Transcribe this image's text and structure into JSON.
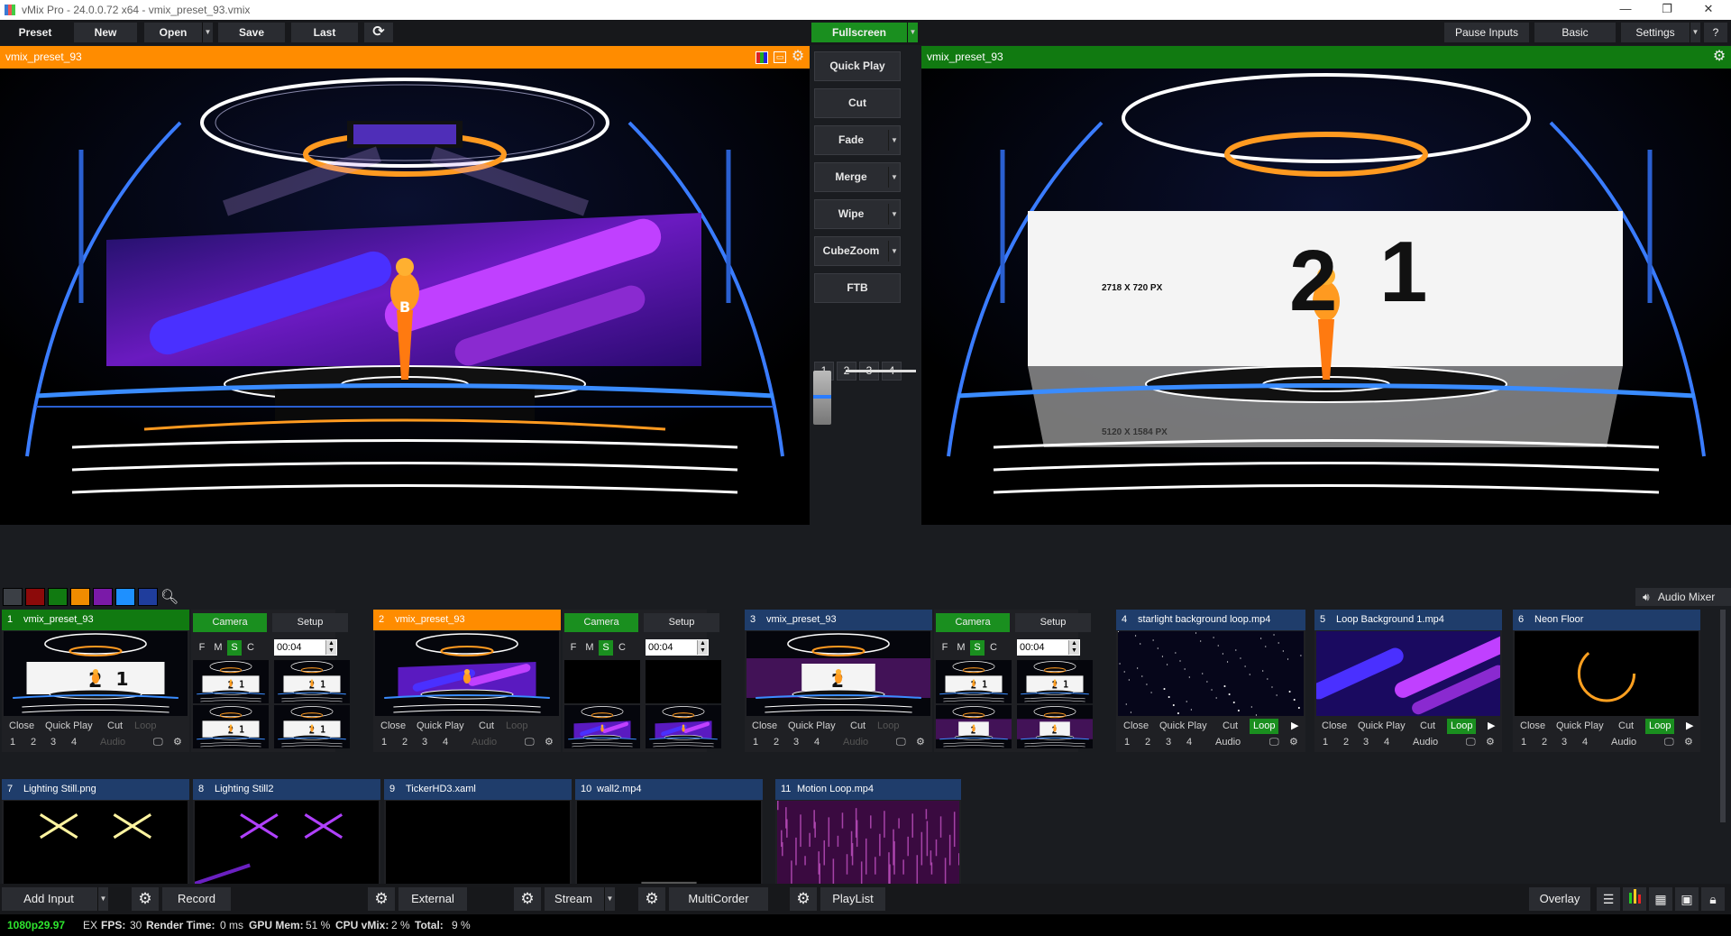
{
  "window": {
    "title": "vMix Pro - 24.0.0.72 x64 - vmix_preset_93.vmix"
  },
  "toolbar": {
    "preset": "Preset",
    "new": "New",
    "open": "Open",
    "save": "Save",
    "last": "Last",
    "fullscreen": "Fullscreen",
    "pause_inputs": "Pause Inputs",
    "basic": "Basic",
    "settings": "Settings",
    "help": "?"
  },
  "preview": {
    "title": "vmix_preset_93",
    "color": "#ff8c00"
  },
  "output": {
    "title": "vmix_preset_93",
    "color": "#117a11"
  },
  "output_screen": {
    "label": "2718 X 720 PX",
    "big": "2",
    "big2": "1",
    "bottom_label": "5120 X 1584 PX"
  },
  "transitions": {
    "quick_play": "Quick Play",
    "cut": "Cut",
    "fade": "Fade",
    "merge": "Merge",
    "wipe": "Wipe",
    "cubezoom": "CubeZoom",
    "ftb": "FTB",
    "numbers": [
      "1",
      "2",
      "3",
      "4"
    ],
    "tbar_position": 0.3
  },
  "color_tags": [
    "#3b3f45",
    "#8c0a0a",
    "#117a11",
    "#f08c00",
    "#7a1aa8",
    "#1e90ff",
    "#1f3d9c"
  ],
  "audio_mixer": "Audio Mixer",
  "inputs": [
    {
      "num": "1",
      "title": "vmix_preset_93",
      "head": "#117a11"
    },
    {
      "num": "2",
      "title": "vmix_preset_93",
      "head": "#ff8c00"
    },
    {
      "num": "3",
      "title": "vmix_preset_93",
      "head": "#1f3d6b"
    },
    {
      "num": "4",
      "title": "starlight background loop.mp4",
      "head": "#1f3d6b"
    },
    {
      "num": "5",
      "title": "Loop Background 1.mp4",
      "head": "#1f3d6b"
    },
    {
      "num": "6",
      "title": "Neon Floor",
      "head": "#1f3d6b"
    },
    {
      "num": "7",
      "title": "Lighting Still.png",
      "head": "#1f3d6b"
    },
    {
      "num": "8",
      "title": "Lighting Still2",
      "head": "#1f3d6b"
    },
    {
      "num": "9",
      "title": "TickerHD3.xaml",
      "head": "#1f3d6b"
    },
    {
      "num": "10",
      "title": "wall2.mp4",
      "head": "#1f3d6b"
    },
    {
      "num": "11",
      "title": "Motion Loop.mp4",
      "head": "#1f3d6b"
    }
  ],
  "tile_controls": {
    "close": "Close",
    "quick_play": "Quick Play",
    "cut": "Cut",
    "loop": "Loop",
    "audio": "Audio",
    "n1": "1",
    "n2": "2",
    "n3": "3",
    "n4": "4"
  },
  "camera_panel": {
    "camera": "Camera",
    "setup": "Setup",
    "f": "F",
    "m": "M",
    "s": "S",
    "c": "C",
    "time": "00:04"
  },
  "bottom": {
    "add_input": "Add Input",
    "record": "Record",
    "external": "External",
    "stream": "Stream",
    "multicorder": "MultiCorder",
    "playlist": "PlayList",
    "overlay": "Overlay"
  },
  "status": {
    "format": "1080p29.97",
    "ex": "EX",
    "fps_label": "FPS:",
    "fps": "30",
    "render_label": "Render Time:",
    "render": "0 ms",
    "gpu_label": "GPU Mem:",
    "gpu": "51 %",
    "cpu_label": "CPU vMix:",
    "cpu": "2 %",
    "total_label": "Total:",
    "total": "9 %"
  }
}
